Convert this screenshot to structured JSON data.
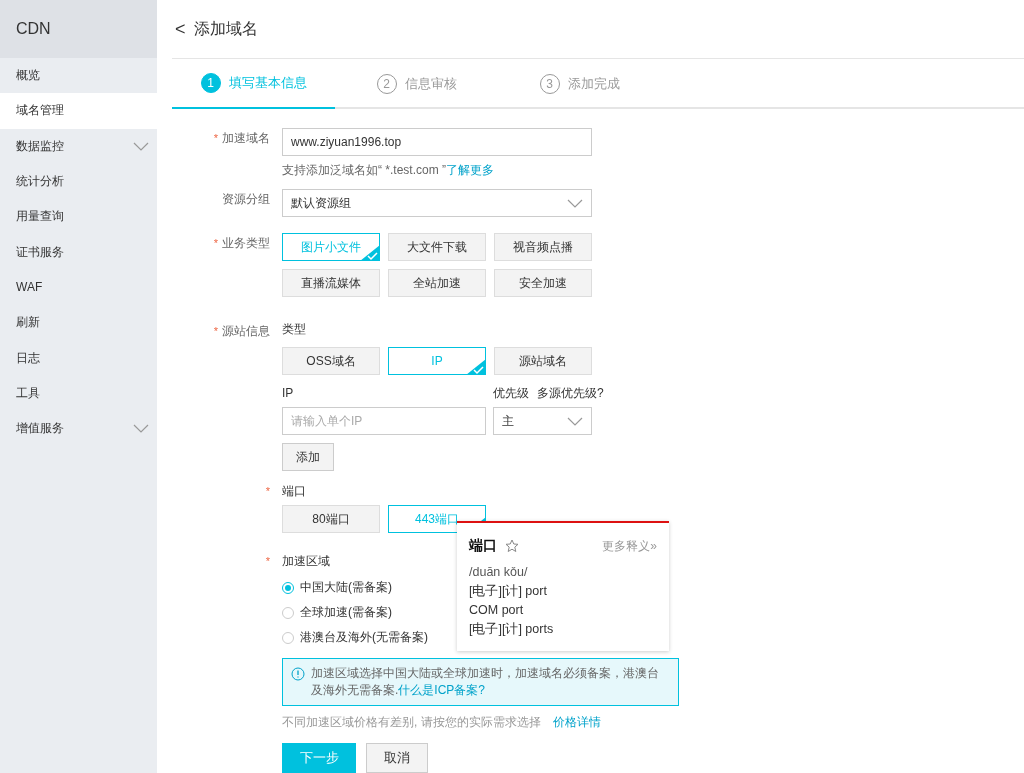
{
  "sidebar": {
    "title": "CDN",
    "items": [
      {
        "label": "概览",
        "selected": false,
        "expandable": false
      },
      {
        "label": "域名管理",
        "selected": true,
        "expandable": false
      },
      {
        "label": "数据监控",
        "selected": false,
        "expandable": true
      },
      {
        "label": "统计分析",
        "selected": false,
        "expandable": false
      },
      {
        "label": "用量查询",
        "selected": false,
        "expandable": false
      },
      {
        "label": "证书服务",
        "selected": false,
        "expandable": false
      },
      {
        "label": "WAF",
        "selected": false,
        "expandable": false
      },
      {
        "label": "刷新",
        "selected": false,
        "expandable": false
      },
      {
        "label": "日志",
        "selected": false,
        "expandable": false
      },
      {
        "label": "工具",
        "selected": false,
        "expandable": false
      },
      {
        "label": "增值服务",
        "selected": false,
        "expandable": true
      }
    ]
  },
  "page": {
    "back": "<",
    "title": "添加域名"
  },
  "steps": [
    {
      "number": "1",
      "label": "填写基本信息",
      "selected": true
    },
    {
      "number": "2",
      "label": "信息审核",
      "selected": false
    },
    {
      "number": "3",
      "label": "添加完成",
      "selected": false
    }
  ],
  "domain": {
    "label": "加速域名",
    "required": true,
    "value": "www.ziyuan1996.top",
    "hint": "支持添加泛域名如“ *.test.com ”",
    "hint_link": "了解更多"
  },
  "required_mark": "*",
  "group": {
    "label": "资源分组",
    "value": "默认资源组"
  },
  "business": {
    "label": "业务类型",
    "required": true,
    "options": [
      {
        "label": "图片小文件",
        "selected": true
      },
      {
        "label": "大文件下载",
        "selected": false
      },
      {
        "label": "视音频点播",
        "selected": false
      },
      {
        "label": "直播流媒体",
        "selected": false
      },
      {
        "label": "全站加速",
        "selected": false
      },
      {
        "label": "安全加速",
        "selected": false
      }
    ]
  },
  "origin": {
    "label": "源站信息",
    "required": true,
    "type_label": "类型",
    "types": [
      {
        "label": "OSS域名",
        "selected": false
      },
      {
        "label": "IP",
        "selected": true
      },
      {
        "label": "源站域名",
        "selected": false
      }
    ],
    "ip_label": "IP",
    "ip_placeholder": "请输入单个IP",
    "priority_label": "优先级",
    "priority_link": "多源优先级?",
    "priority_value": "主",
    "add_button": "添加"
  },
  "port": {
    "label": "端口",
    "required": true,
    "options": [
      {
        "label": "80端口",
        "selected": false
      },
      {
        "label": "443端口",
        "selected": true
      }
    ]
  },
  "region": {
    "label": "加速区域",
    "required": true,
    "options": [
      {
        "label": "中国大陆(需备案)",
        "selected": true
      },
      {
        "label": "全球加速(需备案)",
        "selected": false
      },
      {
        "label": "港澳台及海外(无需备案)",
        "selected": false
      }
    ],
    "notice": "加速区域选择中国大陆或全球加速时，加速域名必须备案，港澳台及海外无需备案.",
    "notice_link": "什么是ICP备案?",
    "price_note": "不同加速区域价格有差别, 请按您的实际需求选择",
    "price_link": "价格详情"
  },
  "actions": {
    "next": "下一步",
    "cancel": "取消"
  },
  "dictionary_popup": {
    "word": "端口",
    "more": "更多释义»",
    "pronunciation": "/duān kǒu/",
    "definitions": [
      "[电子][计] port",
      "COM port",
      "[电子][计] ports"
    ]
  }
}
